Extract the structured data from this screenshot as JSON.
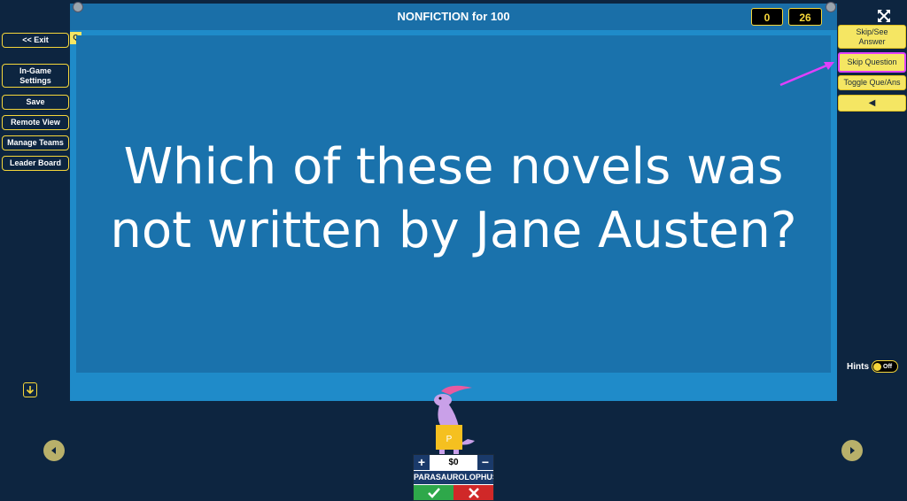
{
  "header": {
    "title": "NONFICTION for 100",
    "q_badge": "Q"
  },
  "scores": {
    "left": "0",
    "right": "26"
  },
  "left_menu": {
    "exit": "<< Exit",
    "in_game_settings_line1": "In-Game",
    "in_game_settings_line2": "Settings",
    "save": "Save",
    "remote_view": "Remote View",
    "manage_teams": "Manage Teams",
    "leader_board": "Leader Board"
  },
  "right_menu": {
    "skip_see_line1": "Skip/See",
    "skip_see_line2": "Answer",
    "skip_question": "Skip Question",
    "toggle": "Toggle Que/Ans",
    "sound": "◀"
  },
  "question": {
    "text": "Which of these novels was not written by Jane Austen?"
  },
  "hints": {
    "label": "Hints",
    "state": "Off"
  },
  "team": {
    "money": "$0",
    "name": "PARASAUROLOPHUS",
    "badge_letter": "P",
    "plus": "+",
    "minus": "−"
  },
  "colors": {
    "background": "#0d2540",
    "board": "#1f8bc9",
    "accent_yellow": "#f5d63a",
    "highlight_magenta": "#e040fb"
  }
}
